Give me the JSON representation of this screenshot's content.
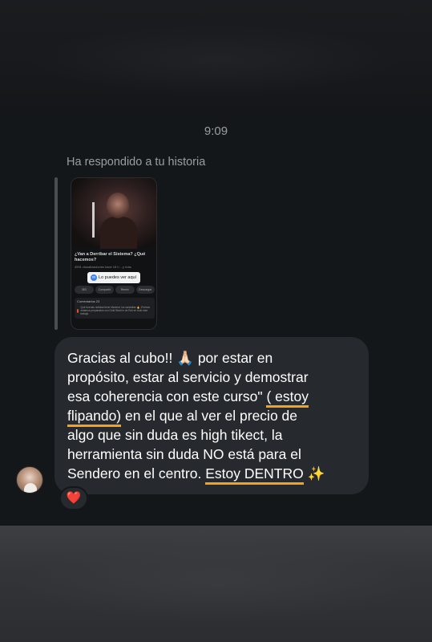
{
  "timestamp": "9:09",
  "reply": {
    "label": "Ha respondido a tu historia",
    "story": {
      "title": "¿Van a Derribar el Sistema? ¿Qué hacemos?",
      "subtitle": "4591 visualizaciones  hace 18 h  ...y más",
      "link_text": "Lo puedes ver aquí",
      "actions": [
        "383",
        "Compartir",
        "Remix",
        "Descargar"
      ],
      "comments_header": "Comentarios 23",
      "comment_text": "Qué buenas noticias tiene Marshal, los sandalias 🔥 ¡Fuimos estamos preparados con Gold Ward in de Roli en todo este trabajo"
    }
  },
  "message": {
    "lines": [
      "Gracias al cubo!! 🙏🏻 por estar en",
      "propósito, estar al servicio y demostrar",
      "esa coherencia con este curso\" ",
      "( estoy",
      "flipando)",
      " en el que al ver el precio de",
      "algo que sin duda es high tikect, la",
      "herramienta sin duda NO está para el",
      "Sendero en el centro. ",
      "Estoy DENTRO",
      " ✨"
    ],
    "highlight_color": "#f7a21a"
  },
  "reaction": {
    "emoji": "❤️"
  }
}
